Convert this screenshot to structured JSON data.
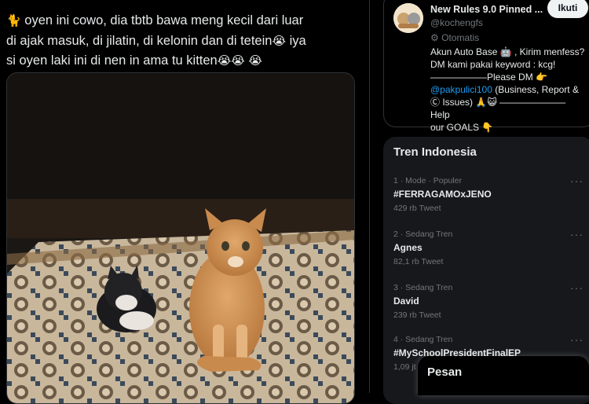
{
  "tweet": {
    "text_line1": "oyen ini cowo, dia tbtb bawa meng kecil dari luar",
    "text_line2": "di ajak masuk, di jilatin, di kelonin dan di tetein",
    "text_line2_end": "iya",
    "text_line3": "si oyen laki ini di nen in ama tu kitten",
    "emoji_cat": "🐈",
    "emoji_cry": "😭",
    "media_icon": "cat-photo"
  },
  "sidebar_account": {
    "name": "New Rules 9.0 Pinned ...",
    "handle": "@kochengfs",
    "follow_label": "Ikuti",
    "bot_label": "Otomatis",
    "bio_line1": "Akun Auto Base 🤖 , Kirim menfess?",
    "bio_line2": "DM kami pakai keyword : kcg!",
    "bio_line3": "——————Please DM 👉",
    "bio_link": "@pakpulici100",
    "bio_line4": "(Business, Report &",
    "bio_line5": "Ⓒ Issues) 🙏😺 ——————— Help",
    "bio_line6": "our GOALS 👇"
  },
  "trends": {
    "title": "Tren Indonesia",
    "items": [
      {
        "meta": "1 · Mode · Populer",
        "name": "#FERRAGAMOxJENO",
        "count": "429 rb Tweet"
      },
      {
        "meta": "2 · Sedang Tren",
        "name": "Agnes",
        "count": "82,1 rb Tweet"
      },
      {
        "meta": "3 · Sedang Tren",
        "name": "David",
        "count": "239 rb Tweet"
      },
      {
        "meta": "4 · Sedang Tren",
        "name": "#MySchoolPresidentFinalEP",
        "count": "1,09 jt"
      }
    ],
    "more_icon": "···"
  },
  "messages": {
    "label": "Pesan"
  },
  "colors": {
    "background": "#000000",
    "accent_link": "#1d9bf0",
    "trend_card_bg": "#16181c",
    "muted_text": "#71767b"
  }
}
